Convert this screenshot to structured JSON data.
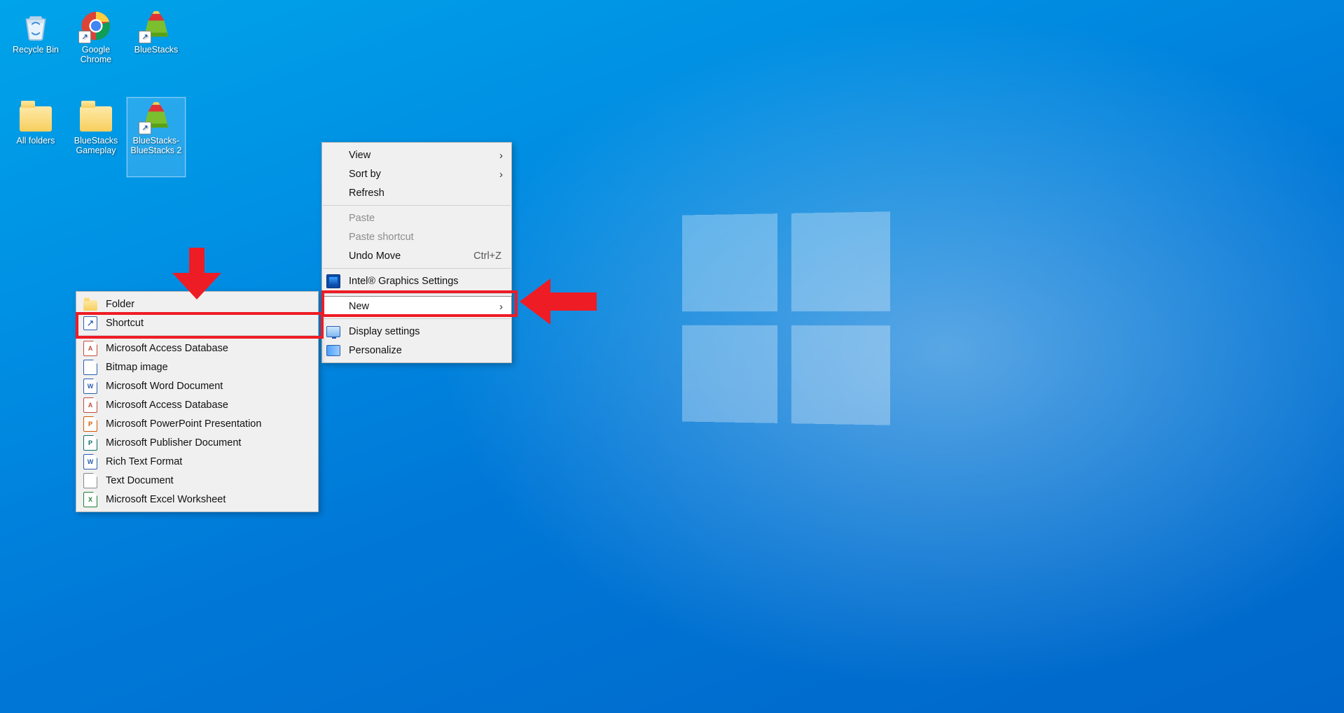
{
  "desktop": {
    "icons_row1": [
      {
        "name": "recycle-bin",
        "label": "Recycle Bin"
      },
      {
        "name": "google-chrome",
        "label": "Google Chrome"
      },
      {
        "name": "bluestacks",
        "label": "BlueStacks"
      }
    ],
    "icons_row2": [
      {
        "name": "all-folders",
        "label": "All folders"
      },
      {
        "name": "bluestacks-gameplay",
        "label": "BlueStacks Gameplay"
      },
      {
        "name": "bluestacks-bluestacks-2",
        "label": "BlueStacks-BlueStacks 2"
      }
    ]
  },
  "context_menu": {
    "view": "View",
    "sort_by": "Sort by",
    "refresh": "Refresh",
    "paste": "Paste",
    "paste_shortcut": "Paste shortcut",
    "undo_move": "Undo Move",
    "undo_shortcut": "Ctrl+Z",
    "intel": "Intel® Graphics Settings",
    "new": "New",
    "display_settings": "Display settings",
    "personalize": "Personalize"
  },
  "new_submenu": {
    "folder": "Folder",
    "shortcut": "Shortcut",
    "items": [
      {
        "type": "red",
        "code": "A",
        "label": "Microsoft Access Database"
      },
      {
        "type": "blue",
        "code": "",
        "label": "Bitmap image"
      },
      {
        "type": "blue",
        "code": "W",
        "label": "Microsoft Word Document"
      },
      {
        "type": "red",
        "code": "A",
        "label": "Microsoft Access Database"
      },
      {
        "type": "orange",
        "code": "P",
        "label": "Microsoft PowerPoint Presentation"
      },
      {
        "type": "teal",
        "code": "P",
        "label": "Microsoft Publisher Document"
      },
      {
        "type": "blue",
        "code": "W",
        "label": "Rich Text Format"
      },
      {
        "type": "gray",
        "code": "",
        "label": "Text Document"
      },
      {
        "type": "green",
        "code": "X",
        "label": "Microsoft Excel Worksheet"
      }
    ]
  },
  "annotation": {
    "arrow_color": "#ee1c25"
  }
}
